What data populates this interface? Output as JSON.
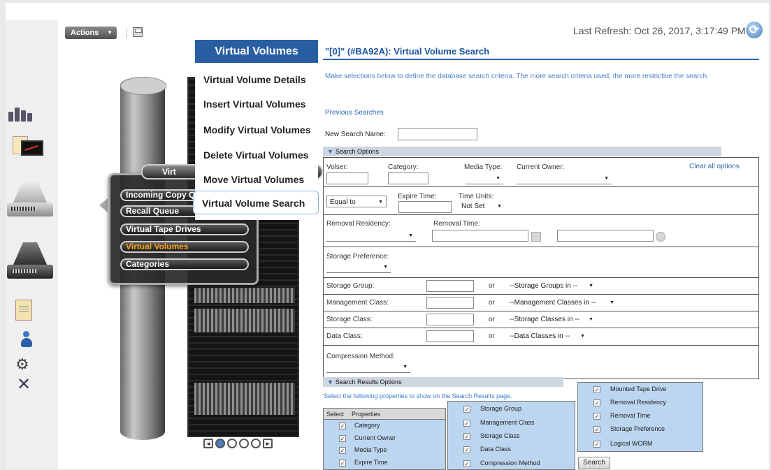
{
  "header": {
    "actions_label": "Actions",
    "last_refresh_label": "Last Refresh:",
    "last_refresh_value": "Oct 26, 2017, 3:17:49 PM"
  },
  "popup": {
    "title": "Virt",
    "items": [
      {
        "label": "Incoming Copy Qu",
        "selected": false
      },
      {
        "label": "Recall Queue",
        "selected": false
      },
      {
        "label": "Virtual Tape Drives",
        "selected": false
      },
      {
        "label": "Virtual Volumes",
        "selected": true
      },
      {
        "label": "Categories",
        "selected": false
      }
    ]
  },
  "flyout": {
    "title": "Virtual Volumes",
    "items": [
      "Virtual Volume Details",
      "Insert Virtual Volumes",
      "Modify Virtual Volumes",
      "Delete Virtual Volumes",
      "Move Virtual Volumes",
      "Virtual Volume Search"
    ],
    "active_index": 5
  },
  "search": {
    "title": "\"[0]\" (#BA92A): Virtual Volume Search",
    "instructions": "Make selections below to define the database search criteria. The more search criteria used, the more restrictive the search.",
    "previous_searches": "Previous Searches",
    "new_search_name_label": "New Search Name:",
    "new_search_name_value": "",
    "search_options_label": "Search Options",
    "clear_all": "Clear all options",
    "volser_label": "Volser:",
    "category_label": "Category:",
    "media_type_label": "Media Type:",
    "current_owner_label": "Current Owner:",
    "expire_op": "Equal to",
    "expire_time_label": "Expire Time:",
    "time_units_label": "Time Units:",
    "time_units_value": "Not Set",
    "removal_residency_label": "Removal Residency:",
    "removal_time_label": "Removal Time:",
    "storage_preference_label": "Storage Preference:",
    "or": "or",
    "storage_group_label": "Storage Group:",
    "storage_group_dd": "--Storage Groups in --",
    "management_class_label": "Management Class:",
    "management_class_dd": "--Management Classes in --",
    "storage_class_label": "Storage Class:",
    "storage_class_dd": "--Storage Classes in --",
    "data_class_label": "Data Class:",
    "data_class_dd": "--Data Classes in --",
    "compression_method_label": "Compression Method:"
  },
  "results_options": {
    "label": "Search Results Options",
    "instructions": "Select the following properties to show on the Search Results page.",
    "select_header": "Select",
    "properties_header": "Properties",
    "col1": [
      "Category",
      "Current Owner",
      "Media Type",
      "Expire Time"
    ],
    "col2": [
      "Storage Group",
      "Management Class",
      "Storage Class",
      "Data Class",
      "Compression Method"
    ],
    "col3": [
      "Mounted Tape Drive",
      "Removal Residency",
      "Removal Time",
      "Storage Preference",
      "Logical WORM"
    ],
    "check_mark": "✓",
    "search_button": "Search"
  }
}
